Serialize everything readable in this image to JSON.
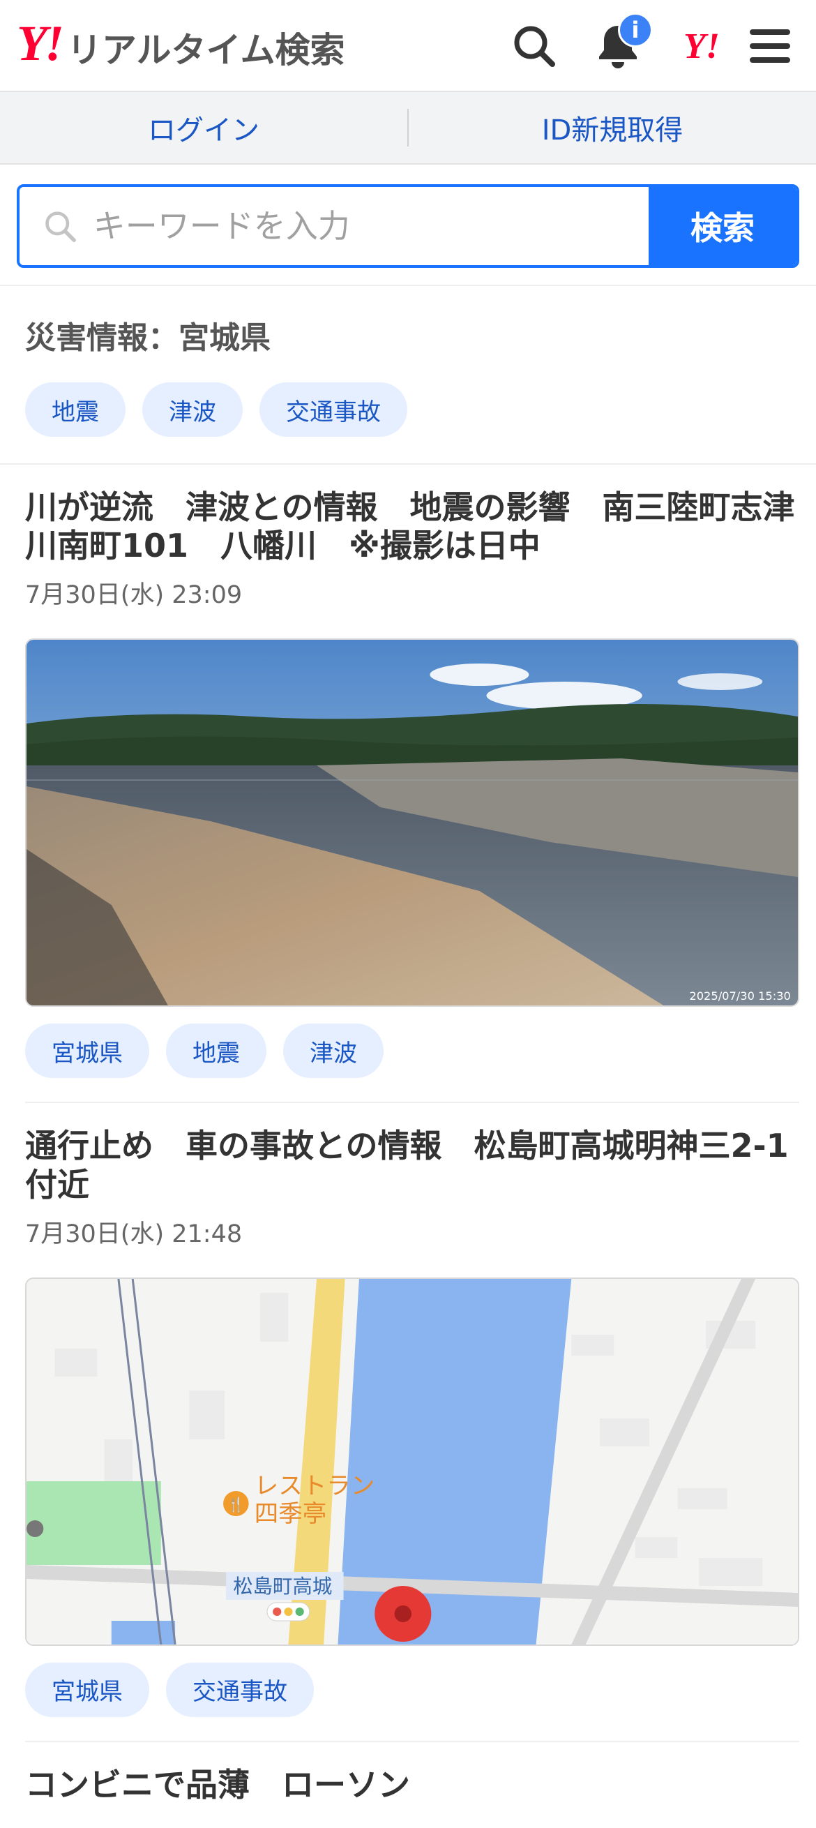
{
  "header": {
    "logo_mark": "Y!",
    "logo_text": "リアルタイム検索",
    "notification_badge": "i",
    "yahoo_icon": "Y!"
  },
  "auth": {
    "login": "ログイン",
    "register": "ID新規取得"
  },
  "search": {
    "placeholder": "キーワードを入力",
    "button": "検索"
  },
  "disaster": {
    "title": "災害情報：宮城県",
    "tags": [
      "地震",
      "津波",
      "交通事故"
    ]
  },
  "posts": [
    {
      "title": "川が逆流　津波との情報　地震の影響　南三陸町志津川南町101　八幡川　※撮影は日中",
      "date": "7月30日(水) 23:09",
      "image_timestamp": "2025/07/30 15:30",
      "tags": [
        "宮城県",
        "地震",
        "津波"
      ]
    },
    {
      "title": "通行止め　車の事故との情報　松島町高城明神三2-1付近",
      "date": "7月30日(水) 21:48",
      "map_labels": {
        "restaurant_line1": "レストラン",
        "restaurant_line2": "四季亭",
        "area": "松島町高城"
      },
      "tags": [
        "宮城県",
        "交通事故"
      ]
    },
    {
      "title": "コンビニで品薄　ローソン"
    }
  ],
  "colors": {
    "accent": "#1a73ff",
    "brand_red": "#ff0033",
    "link": "#1a57c4",
    "tag_bg": "#e5efff"
  }
}
